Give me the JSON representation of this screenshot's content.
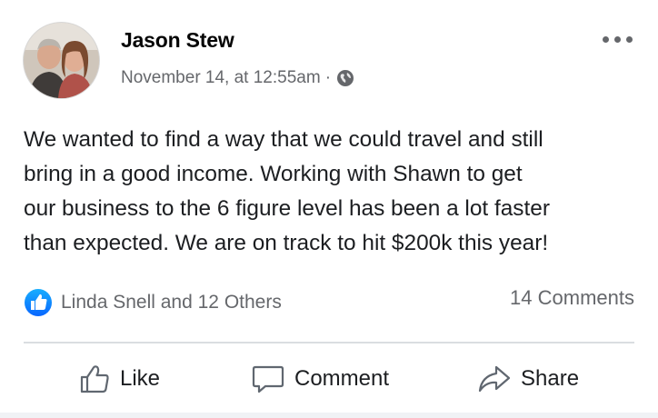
{
  "post": {
    "author_name": "Jason Stew",
    "timestamp": "November 14, at 12:55am",
    "separator": "·",
    "privacy_icon": "globe-icon",
    "more_icon": "more-options-icon",
    "text_lines": [
      "We wanted to find a way that we could travel and still",
      "bring in a good income. Working with Shawn to get",
      "our business to the 6 figure level has been a lot faster",
      "than expected. We are on track to hit $200k this year!"
    ]
  },
  "reactions": {
    "icon": "like-reaction-icon",
    "summary": "Linda Snell and 12 Others",
    "comments": "14 Comments"
  },
  "actions": {
    "like": {
      "label": "Like",
      "icon": "thumbs-up-icon"
    },
    "comment": {
      "label": "Comment",
      "icon": "comment-bubble-icon"
    },
    "share": {
      "label": "Share",
      "icon": "share-arrow-icon"
    }
  },
  "colors": {
    "accent": "#1877f2",
    "secondary_text": "#65676b",
    "divider": "#dadde1"
  }
}
